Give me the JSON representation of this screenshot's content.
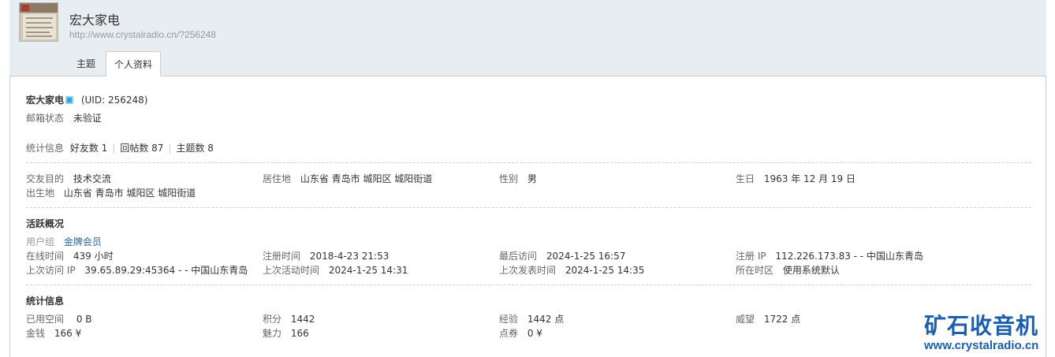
{
  "header": {
    "username": "宏大家电",
    "url": "http://www.crystalradio.cn/?256248",
    "tabs": [
      {
        "label": "主题"
      },
      {
        "label": "个人资料"
      }
    ]
  },
  "profile": {
    "name": "宏大家电",
    "uid": "(UID: 256248)",
    "email_label": "邮箱状态",
    "email_value": "未验证",
    "stats_label": "统计信息",
    "friends": "好友数 1",
    "replies": "回帖数 87",
    "threads": "主题数 8"
  },
  "details": {
    "purpose_label": "交友目的",
    "purpose_value": "技术交流",
    "residence_label": "居住地",
    "residence_value": "山东省 青岛市 城阳区 城阳街道",
    "gender_label": "性别",
    "gender_value": "男",
    "birthday_label": "生日",
    "birthday_value": "1963 年 12 月 19 日",
    "birthplace_label": "出生地",
    "birthplace_value": "山东省 青岛市 城阳区 城阳街道"
  },
  "activity": {
    "title": "活跃概况",
    "group_label": "用户组",
    "group_value": "金牌会员",
    "online_label": "在线时间",
    "online_value": "439 小时",
    "register_label": "注册时间",
    "register_value": "2018-4-23 21:53",
    "last_visit_label": "最后访问",
    "last_visit_value": "2024-1-25 16:57",
    "register_ip_label": "注册 IP",
    "register_ip_value": "112.226.173.83 - - 中国山东青岛",
    "last_ip_label": "上次访问 IP",
    "last_ip_value": "39.65.89.29:45364 - - 中国山东青岛",
    "last_active_label": "上次活动时间",
    "last_active_value": "2024-1-25 14:31",
    "last_post_label": "上次发表时间",
    "last_post_value": "2024-1-25 14:35",
    "timezone_label": "所在时区",
    "timezone_value": "使用系统默认"
  },
  "statistics": {
    "title": "统计信息",
    "space_label": "已用空间",
    "space_value": "0 B",
    "points_label": "积分",
    "points_value": "1442",
    "exp_label": "经验",
    "exp_value": "1442 点",
    "prestige_label": "威望",
    "prestige_value": "1722 点",
    "money_label": "金钱",
    "money_value": "166 ¥",
    "charm_label": "魅力",
    "charm_value": "166",
    "coupon_label": "点券",
    "coupon_value": "0 ¥"
  },
  "watermark": {
    "title": "矿石收音机",
    "url": "www.crystalradio.cn"
  },
  "colors": {
    "header_bg": "#e8edf2",
    "link": "#336699",
    "watermark": "#1b5fae"
  }
}
